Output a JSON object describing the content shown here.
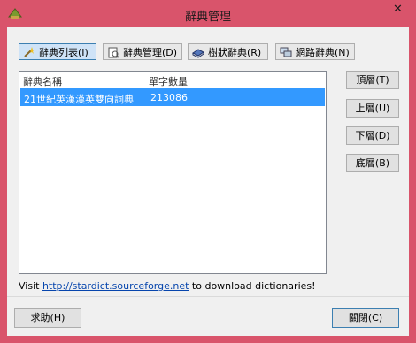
{
  "window": {
    "title": "辭典管理",
    "close_glyph": "✕"
  },
  "toolbar": {
    "tabs": [
      {
        "label": "辭典列表(I)",
        "icon": "wand-icon"
      },
      {
        "label": "辭典管理(D)",
        "icon": "dictionary-manage-icon"
      },
      {
        "label": "樹狀辭典(R)",
        "icon": "book-icon"
      },
      {
        "label": "網路辭典(N)",
        "icon": "network-icon"
      }
    ]
  },
  "list": {
    "columns": [
      "辭典名稱",
      "單字數量"
    ],
    "rows": [
      {
        "name": "21世紀英漢漢英雙向詞典",
        "count": "213086"
      }
    ]
  },
  "side_buttons": {
    "top": "頂層(T)",
    "up": "上層(U)",
    "down": "下層(D)",
    "bottom": "底層(B)"
  },
  "footer": {
    "visit_prefix": "Visit",
    "link": "http://stardict.sourceforge.net",
    "visit_suffix": "to download dictionaries!"
  },
  "buttons": {
    "help": "求助(H)",
    "close": "關閉(C)"
  },
  "colors": {
    "window_frame": "#d9546b",
    "selection": "#3399ff",
    "client_bg": "#f0f0f0"
  }
}
